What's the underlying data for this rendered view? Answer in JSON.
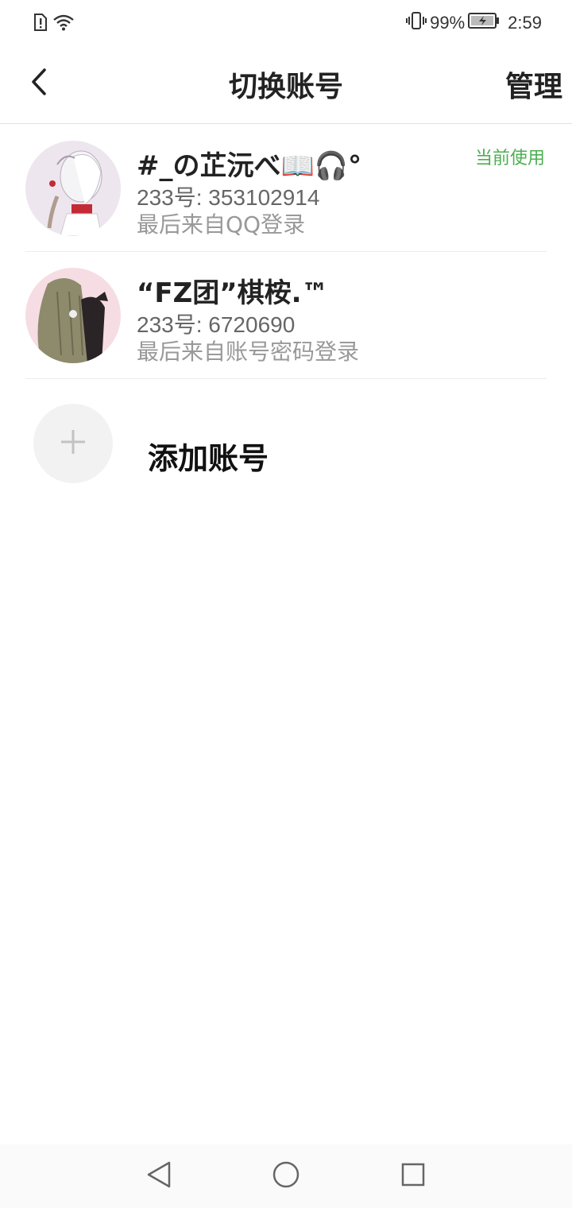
{
  "status_bar": {
    "battery_percent": "99%",
    "time": "2:59",
    "icons": [
      "sim-alert-icon",
      "wifi-icon",
      "vibrate-icon",
      "battery-charging-icon"
    ]
  },
  "header": {
    "title": "切换账号",
    "manage_label": "管理",
    "back_icon": "chevron-left-icon"
  },
  "accounts": [
    {
      "name": "#_の芷沅べ📖🎧°",
      "id_line": "233号: 353102914",
      "login_line": "最后来自QQ登录",
      "badge": "当前使用",
      "badge_color": "#4caf50"
    },
    {
      "name": "“FZ团”棋桉.™",
      "id_line": "233号: 6720690",
      "login_line": "最后来自账号密码登录"
    }
  ],
  "add_account": {
    "label": "添加账号",
    "icon": "plus-icon"
  },
  "nav_bar": {
    "icons": [
      "back-triangle-icon",
      "home-circle-icon",
      "recents-square-icon"
    ]
  }
}
